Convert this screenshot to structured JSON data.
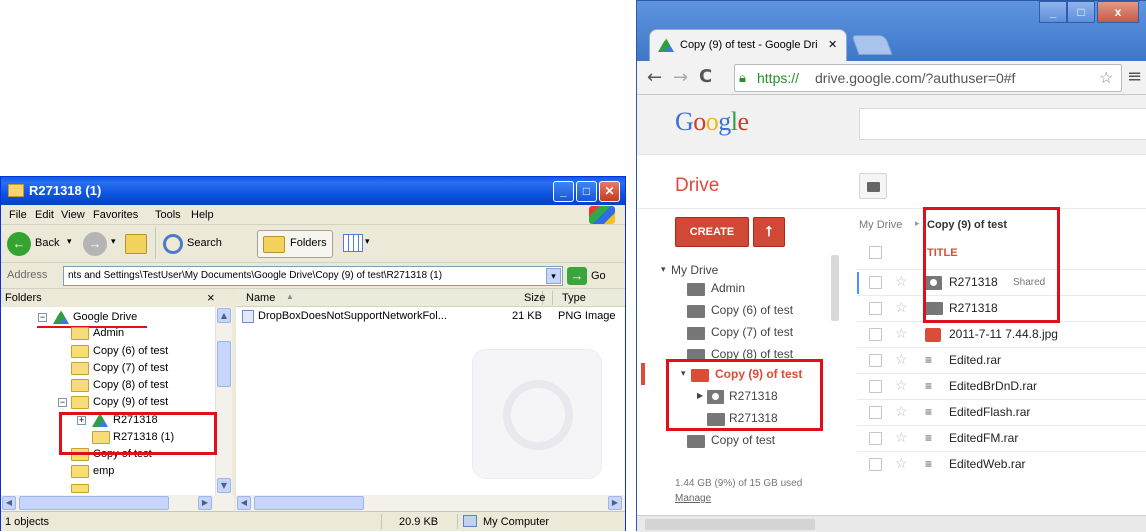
{
  "explorer": {
    "title": "R271318 (1)",
    "menu": [
      "File",
      "Edit",
      "View",
      "Favorites",
      "Tools",
      "Help"
    ],
    "toolbar": {
      "back": "Back",
      "search": "Search",
      "folders": "Folders"
    },
    "address_label": "Address",
    "address": "nts and Settings\\TestUser\\My Documents\\Google Drive\\Copy (9) of test\\R271318 (1)",
    "go": "Go",
    "folders_pane_title": "Folders",
    "close_pane": "×",
    "tree": [
      "Google Drive",
      "Admin",
      "Copy (6) of test",
      "Copy (7) of test",
      "Copy (8) of test",
      "Copy (9) of test",
      "R271318",
      "R271318 (1)",
      "Copy of test",
      "emp"
    ],
    "columns": {
      "name": "Name",
      "size": "Size",
      "type": "Type"
    },
    "files": [
      {
        "name": "DropBoxDoesNotSupportNetworkFol...",
        "size": "21 KB",
        "type": "PNG Image"
      }
    ],
    "status": {
      "objects": "1 objects",
      "size": "20.9 KB",
      "location": "My Computer"
    }
  },
  "chrome": {
    "tab_title": "Copy (9) of test - Google Dri",
    "url_secure": "https://",
    "url_rest": "drive.google.com/?authuser=0#f",
    "google_logo": "Google",
    "drive_label": "Drive",
    "create": "CREATE",
    "nav": [
      "My Drive",
      "Admin",
      "Copy (6) of test",
      "Copy (7) of test",
      "Copy (8) of test",
      "Copy (9) of test",
      "R271318",
      "R271318",
      "Copy of test"
    ],
    "storage": "1.44 GB (9%) of 15 GB used",
    "manage": "Manage",
    "breadcrumb_root": "My Drive",
    "breadcrumb_current": "Copy (9) of test",
    "title_col": "TITLE",
    "files": [
      {
        "name": "R271318",
        "badge": "Shared",
        "icon": "shared-folder-icon"
      },
      {
        "name": "R271318",
        "badge": "",
        "icon": "folder-icon"
      },
      {
        "name": "2011-7-11 7.44.8.jpg",
        "badge": "",
        "icon": "image-icon"
      },
      {
        "name": "Edited.rar",
        "badge": "",
        "icon": "archive-icon"
      },
      {
        "name": "EditedBrDnD.rar",
        "badge": "",
        "icon": "archive-icon"
      },
      {
        "name": "EditedFlash.rar",
        "badge": "",
        "icon": "archive-icon"
      },
      {
        "name": "EditedFM.rar",
        "badge": "",
        "icon": "archive-icon"
      },
      {
        "name": "EditedWeb.rar",
        "badge": "",
        "icon": "archive-icon"
      }
    ]
  },
  "colors": {
    "highlight_box": "#e0101a",
    "drive_red": "#dd4b39",
    "xp_blue": "#0a5ee8"
  }
}
